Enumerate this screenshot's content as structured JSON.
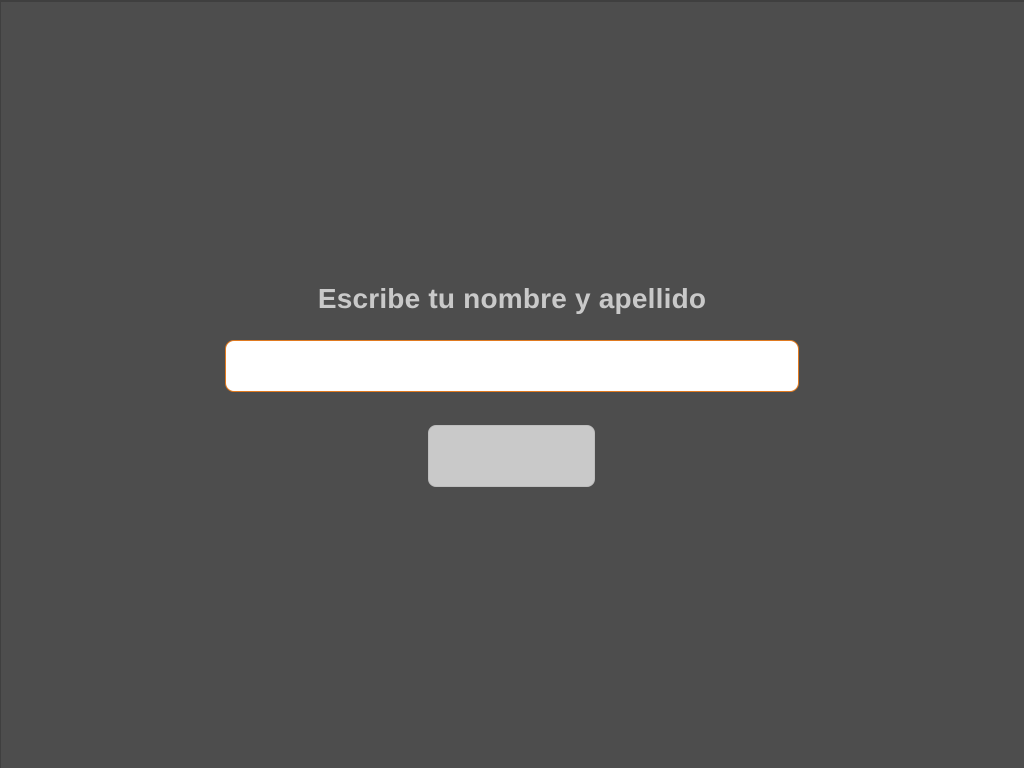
{
  "form": {
    "prompt": "Escribe tu nombre y apellido",
    "name_value": "",
    "submit_label": ""
  },
  "colors": {
    "background": "#4d4d4d",
    "prompt_text": "#c9c9c9",
    "input_background": "#ffffff",
    "input_border": "#e07a20",
    "button_background": "#c9c9c9"
  }
}
